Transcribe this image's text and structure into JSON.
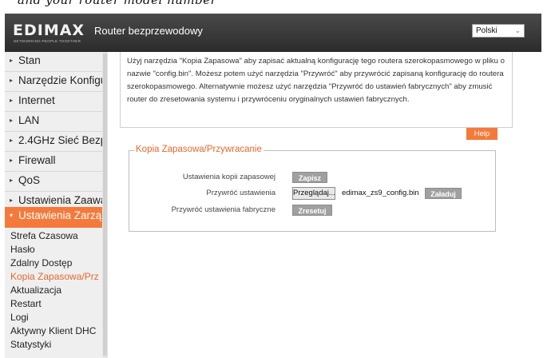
{
  "overlay_text": "and your router model number",
  "app": {
    "logo": "EDIMAX",
    "logo_tagline": "NETWORKING PEOPLE TOGETHER",
    "title": "Router bezprzewodowy",
    "language": "Polski"
  },
  "sidebar": {
    "items": [
      {
        "label": "Stan"
      },
      {
        "label": "Narzędzie Konfigu"
      },
      {
        "label": "Internet"
      },
      {
        "label": "LAN"
      },
      {
        "label": "2.4GHz Sieć Bezp"
      },
      {
        "label": "Firewall"
      },
      {
        "label": "QoS"
      },
      {
        "label": "Ustawienia Zaawa"
      },
      {
        "label": "Ustawienia Zarzą"
      }
    ],
    "subitems": [
      {
        "label": "Strefa Czasowa"
      },
      {
        "label": "Hasło"
      },
      {
        "label": "Zdalny Dostęp"
      },
      {
        "label": "Kopia Zapasowa/Prz"
      },
      {
        "label": "Aktualizacja"
      },
      {
        "label": "Restart"
      },
      {
        "label": "Logi"
      },
      {
        "label": "Aktywny Klient DHC"
      },
      {
        "label": "Statystyki"
      }
    ]
  },
  "description": "Użyj narzędzia \"Kopia Zapasowa\" aby zapisać aktualną konfigurację tego routera szerokopasmowego w pliku o nazwie \"config.bin\". Możesz potem użyć narzędzia \"Przywróć\" aby przywrócić zapisaną konfigurację do routera szerokopasmowego. Alternatywnie możesz użyć narzędzia \"Przywróć do ustawień fabrycznych\" aby zmusić router do zresetowania systemu i przywróceniu oryginalnych ustawień fabrycznych.",
  "help_label": "Help",
  "section": {
    "legend": "Kopia Zapasowa/Przywracanie",
    "backup_label": "Ustawienia kopii zapasowej",
    "backup_button": "Zapisz",
    "restore_label": "Przywróć ustawienia",
    "browse_button": "Przeglądaj...",
    "filename": "edimax_zs9_config.bin",
    "upload_button": "Załaduj",
    "factory_label": "Przywróć ustawienia fabryczne",
    "reset_button": "Zresetuj"
  },
  "colors": {
    "accent": "#f47a3c",
    "header_bg": "#333333",
    "sidebar_bg": "#efefef"
  }
}
